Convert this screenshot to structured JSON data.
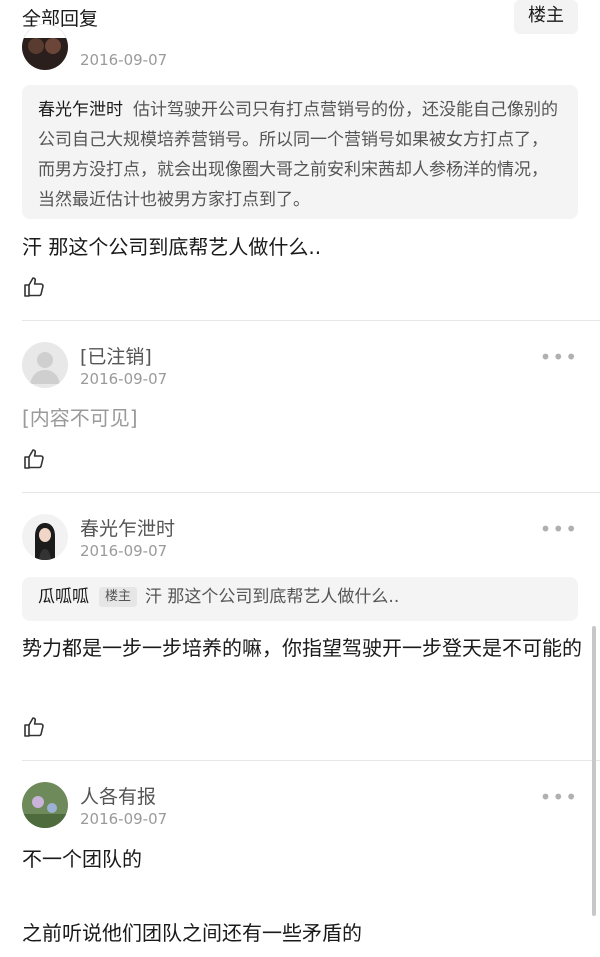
{
  "header": {
    "all_replies": "全部回复",
    "owner_only": "楼主"
  },
  "comments": [
    {
      "date": "2016-09-07",
      "quote": {
        "name": "春光乍泄时",
        "text": "估计驾驶开公司只有打点营销号的份，还没能自己像别的公司自己大规模培养营销号。所以同一个营销号如果被女方打点了，而男方没打点，就会出现像圈大哥之前安利宋茜却人参杨洋的情况，当然最近估计也被男方家打点到了。"
      },
      "content": "汗 那这个公司到底帮艺人做什么.."
    },
    {
      "name": "[已注销]",
      "date": "2016-09-07",
      "content": "[内容不可见]"
    },
    {
      "name": "春光乍泄时",
      "date": "2016-09-07",
      "quote": {
        "name": "瓜呱呱",
        "badge": "楼主",
        "text": "汗 那这个公司到底帮艺人做什么.."
      },
      "content": "势力都是一步一步培养的嘛，你指望驾驶开一步登天是不可能的"
    },
    {
      "name": "人各有报",
      "date": "2016-09-07",
      "content_line1": "不一个团队的",
      "content_line2": "之前听说他们团队之间还有一些矛盾的"
    }
  ],
  "icons": {
    "like": "thumbs-up-icon",
    "more": "more-dots-icon"
  },
  "more_glyph": "•••",
  "colors": {
    "quote_bg": "#f4f4f4",
    "muted": "#9a9a9a",
    "divider": "#e6e6e6"
  }
}
